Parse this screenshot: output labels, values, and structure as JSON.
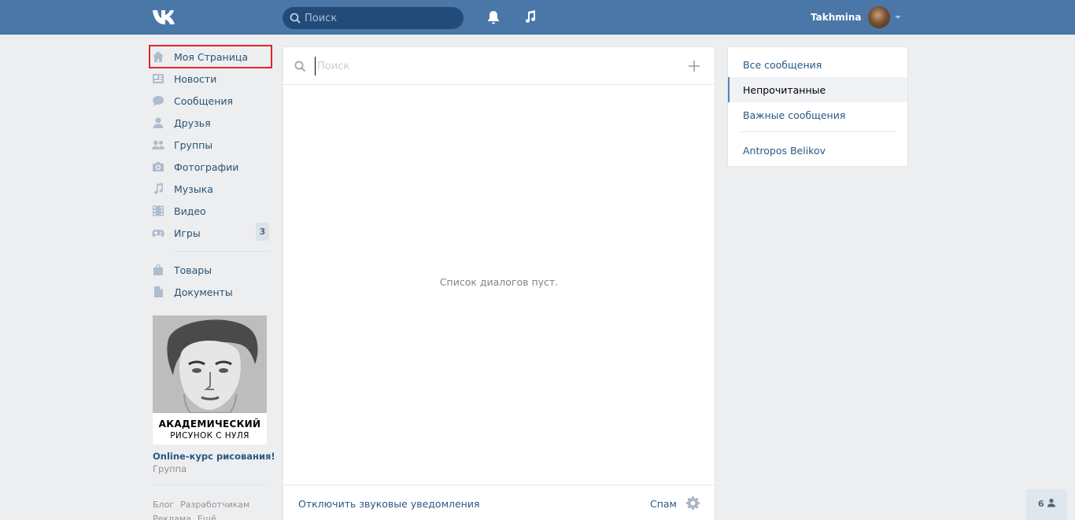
{
  "header": {
    "search_placeholder": "Поиск",
    "user_name": "Takhmina"
  },
  "nav": {
    "items": [
      {
        "label": "Моя Страница",
        "icon": "home-icon"
      },
      {
        "label": "Новости",
        "icon": "news-icon"
      },
      {
        "label": "Сообщения",
        "icon": "messages-icon"
      },
      {
        "label": "Друзья",
        "icon": "friend-icon"
      },
      {
        "label": "Группы",
        "icon": "groups-icon"
      },
      {
        "label": "Фотографии",
        "icon": "camera-icon"
      },
      {
        "label": "Музыка",
        "icon": "music-icon"
      },
      {
        "label": "Видео",
        "icon": "video-icon"
      },
      {
        "label": "Игры",
        "icon": "gamepad-icon",
        "badge": "3"
      }
    ],
    "extra_items": [
      {
        "label": "Товары",
        "icon": "bag-icon"
      },
      {
        "label": "Документы",
        "icon": "document-icon"
      }
    ]
  },
  "ad": {
    "line1": "АКАДЕМИЧЕСКИЙ",
    "line2": "РИСУНОК С НУЛЯ",
    "title": "Online-курс рисования!",
    "subtitle": "Группа"
  },
  "footer": {
    "links": [
      "Блог",
      "Разработчикам",
      "Реклама",
      "Ещё"
    ]
  },
  "messages": {
    "search_placeholder": "Поиск",
    "empty_text": "Список диалогов пуст.",
    "mute_label": "Отключить звуковые уведомления",
    "spam_label": "Спам"
  },
  "filters": {
    "items": [
      "Все сообщения",
      "Непрочитанные",
      "Важные сообщения"
    ],
    "selected": "Непрочитанные",
    "contact": "Antropos Belikov"
  },
  "online_widget": {
    "count": "6"
  },
  "colors": {
    "header_bg": "#4a76a8",
    "link": "#2a5885",
    "page_bg": "#edeef0"
  }
}
